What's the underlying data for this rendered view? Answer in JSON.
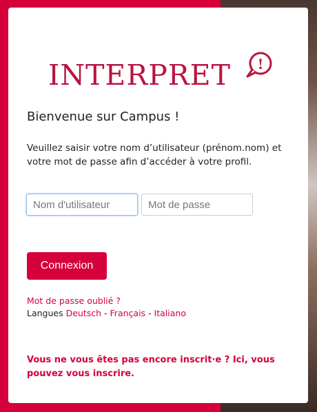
{
  "brand": {
    "logo_text": "INTERPRET",
    "logo_mark": "!",
    "accent": "#d5003c"
  },
  "login": {
    "welcome": "Bienvenue sur Campus !",
    "intro": "Veuillez saisir votre nom d’utilisateur (prénom.nom) et votre mot de passe afin d’accéder à votre profil.",
    "username_placeholder": "Nom d'utilisateur",
    "username_value": "",
    "password_placeholder": "Mot de passe",
    "password_value": "",
    "submit_label": "Connexion"
  },
  "links": {
    "forgot_password": "Mot de passe oublié ?",
    "languages_label": "Langues",
    "languages": [
      "Deutsch",
      "Français",
      "Italiano"
    ],
    "separator": "-"
  },
  "signup": {
    "text": "Vous ne vous êtes pas encore inscrit·e ?",
    "link": "Ici, vous pouvez vous inscrire."
  }
}
